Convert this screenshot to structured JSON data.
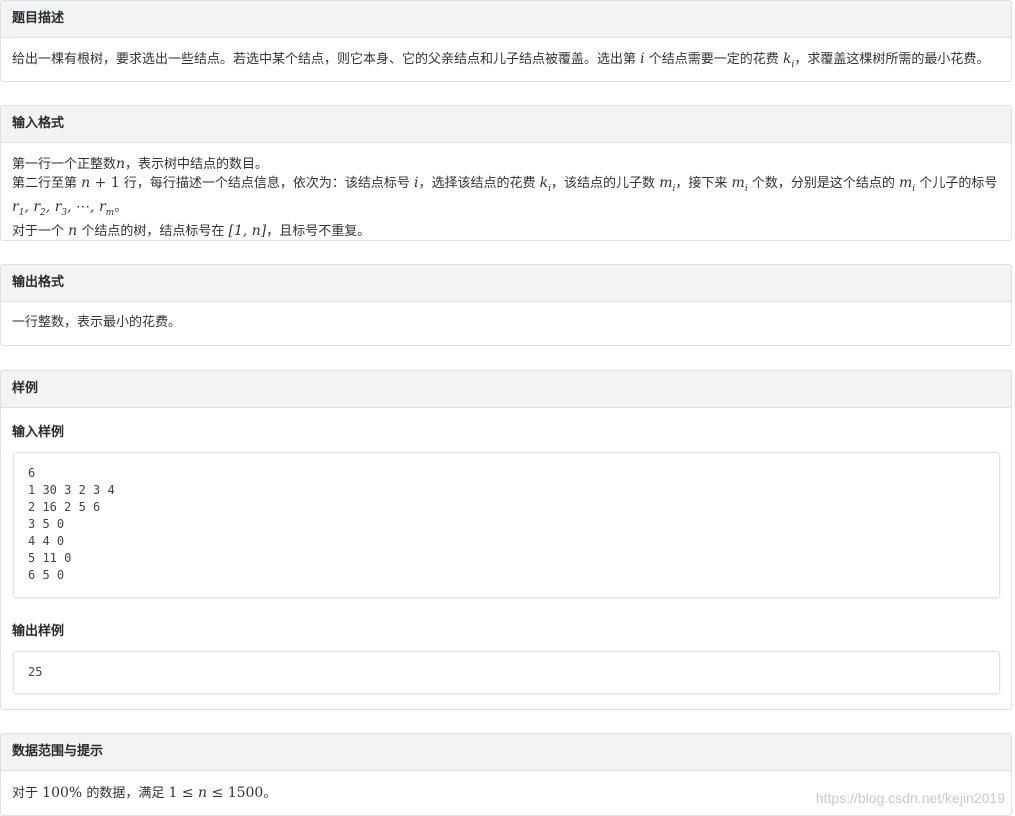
{
  "sections": {
    "description": {
      "title": "题目描述",
      "text_1": "给出一棵有根树，要求选出一些结点。若选中某个结点，则它本身、它的父亲结点和儿子结点被覆盖。选出第",
      "var_i": "i",
      "text_2": "个结点需要一定的花费",
      "var_k": "k",
      "sub_i": "i",
      "text_3": "，求覆盖这棵树所需的最小花费。"
    },
    "input_format": {
      "title": "输入格式",
      "line1_a": "第一行一个正整数",
      "line1_n": "n",
      "line1_b": "，表示树中结点的数目。",
      "line2_a": "第二行至第",
      "line2_expr_n": "n",
      "line2_expr_rest": " + 1",
      "line2_b": "行，每行描述一个结点信息，依次为：该结点标号",
      "line2_i": "i",
      "line2_c": "，选择该结点的花费",
      "line2_k": "k",
      "line2_d": "，该结点的儿子数",
      "line2_m": "m",
      "line2_e": "，接下来",
      "line2_f": "个数，分别是这个结点的",
      "line2_g": "个儿子的标号",
      "line3_r": "r",
      "line3_subs": [
        "1",
        "2",
        "3",
        "m"
      ],
      "line3_dots": "⋯",
      "line3_end": "。",
      "line4_a": "对于一个",
      "line4_b": "个结点的树，结点标号在",
      "line4_range": "[1, n]",
      "line4_c": "，且标号不重复。"
    },
    "output_format": {
      "title": "输出格式",
      "text": "一行整数，表示最小的花费。"
    },
    "samples": {
      "title": "样例",
      "input_title": "输入样例",
      "input_lines": [
        "6",
        "1 30 3 2 3 4",
        "2 16 2 5 6",
        "3 5 0",
        "4 4 0",
        "5 11 0",
        "6 5 0"
      ],
      "output_title": "输出样例",
      "output_lines": [
        "25"
      ]
    },
    "constraints": {
      "title": "数据范围与提示",
      "text_a": "对于",
      "percent": "100%",
      "text_b": "的数据，满足",
      "expr_left": "1 ≤ ",
      "expr_n": "n",
      "expr_right": " ≤ 1500",
      "text_c": "。"
    }
  },
  "watermark": "https://blog.csdn.net/kejin2019"
}
